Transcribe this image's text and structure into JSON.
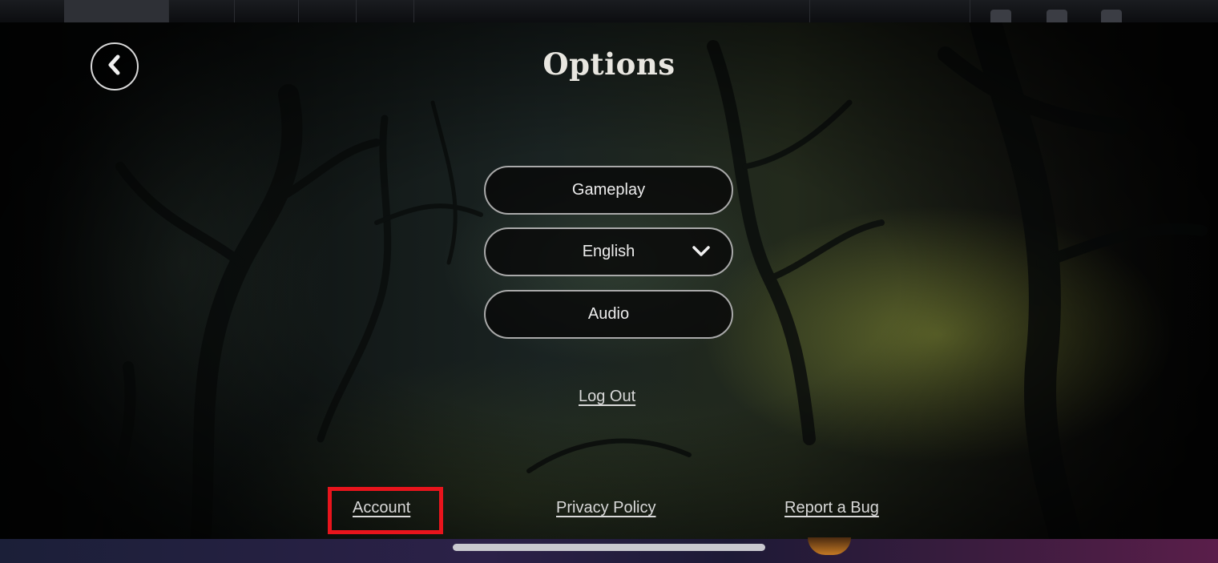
{
  "page": {
    "title": "Options"
  },
  "menu": {
    "gameplay_label": "Gameplay",
    "language_value": "English",
    "audio_label": "Audio"
  },
  "links": {
    "logout_label": "Log Out",
    "account_label": "Account",
    "privacy_label": "Privacy Policy",
    "report_bug_label": "Report a Bug"
  },
  "icons": {
    "back": "chevron-left-icon",
    "dropdown": "chevron-down-icon"
  },
  "colors": {
    "highlight": "#e8141c",
    "button_border": "#a9a9a9",
    "text": "#ececec"
  }
}
